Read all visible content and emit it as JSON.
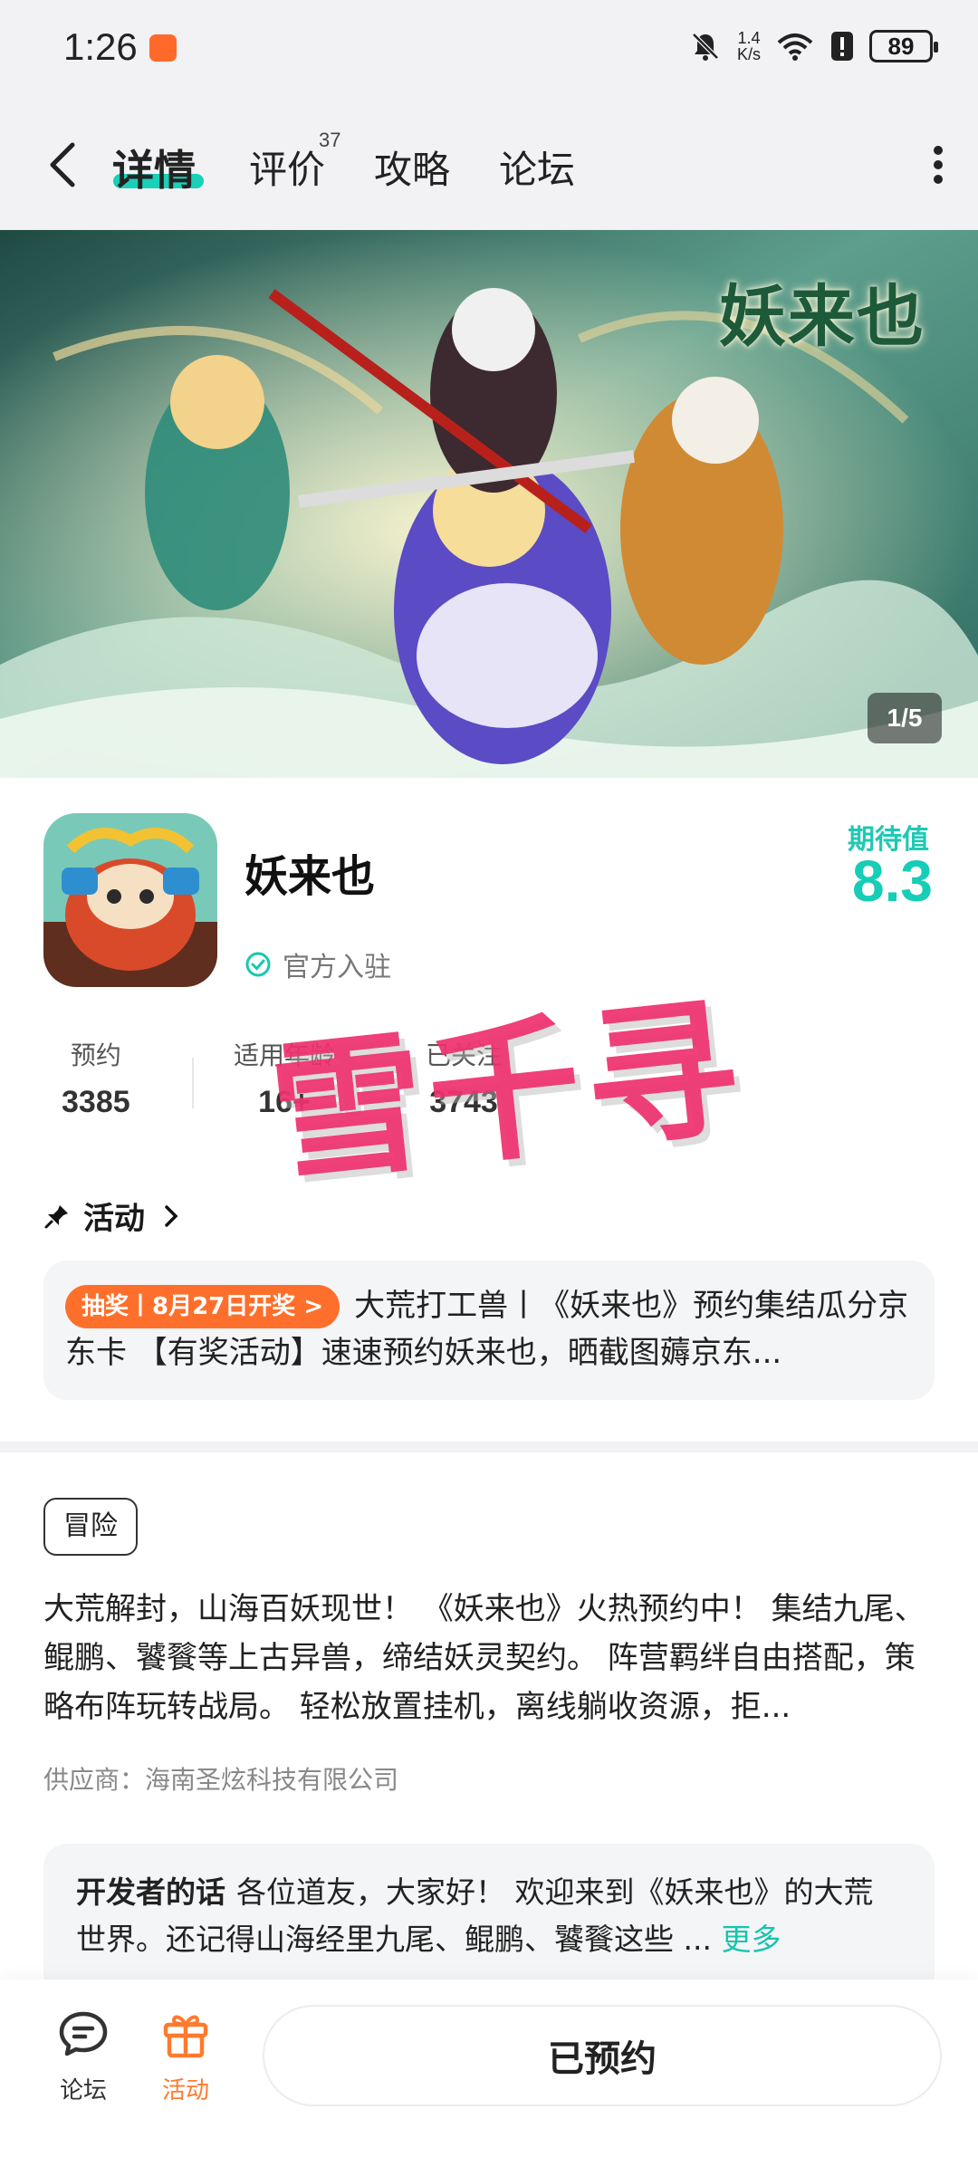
{
  "status_bar": {
    "time": "1:26",
    "net_speed_value": "1.4",
    "net_speed_unit": "K/s",
    "battery": "89"
  },
  "nav": {
    "tabs": [
      {
        "label": "详情",
        "active": true
      },
      {
        "label": "评价",
        "badge": "37"
      },
      {
        "label": "攻略"
      },
      {
        "label": "论坛"
      }
    ]
  },
  "banner": {
    "logo_text": "妖来也",
    "counter": "1/5"
  },
  "game": {
    "title": "妖来也",
    "official_label": "官方入驻",
    "expect_label": "期待值",
    "expect_value": "8.3"
  },
  "stats": [
    {
      "label": "预约",
      "value": "3385"
    },
    {
      "label": "适用年龄",
      "value": "16+"
    },
    {
      "label": "已关注",
      "value": "3743"
    }
  ],
  "watermark": "雪千寻",
  "activity": {
    "header": "活动",
    "badge": "抽奖丨8月27日开奖 >",
    "text": "大荒打工兽丨《妖来也》预约集结瓜分京东卡 【有奖活动】速速预约妖来也，晒截图薅京东..."
  },
  "genre_tag": "冒险",
  "description": "大荒解封，山海百妖现世！ 《妖来也》火热预约中！ 集结九尾、鲲鹏、饕餮等上古异兽，缔结妖灵契约。 阵营羁绊自由搭配，策略布阵玩转战局。 轻松放置挂机，离线躺收资源，拒...",
  "supplier": "供应商：海南圣炫科技有限公司",
  "developer": {
    "label": "开发者的话",
    "text": "各位道友，大家好！ 欢迎来到《妖来也》的大荒世界。还记得山海经里九尾、鲲鹏、饕餮这些 ...",
    "more": "更多"
  },
  "bottom_bar": {
    "forum_label": "论坛",
    "activity_label": "活动",
    "reserve_label": "已预约"
  },
  "colors": {
    "accent_teal": "#16cdb6",
    "activity_orange": "#ff6f2c",
    "watermark_pink": "#ee306e"
  }
}
